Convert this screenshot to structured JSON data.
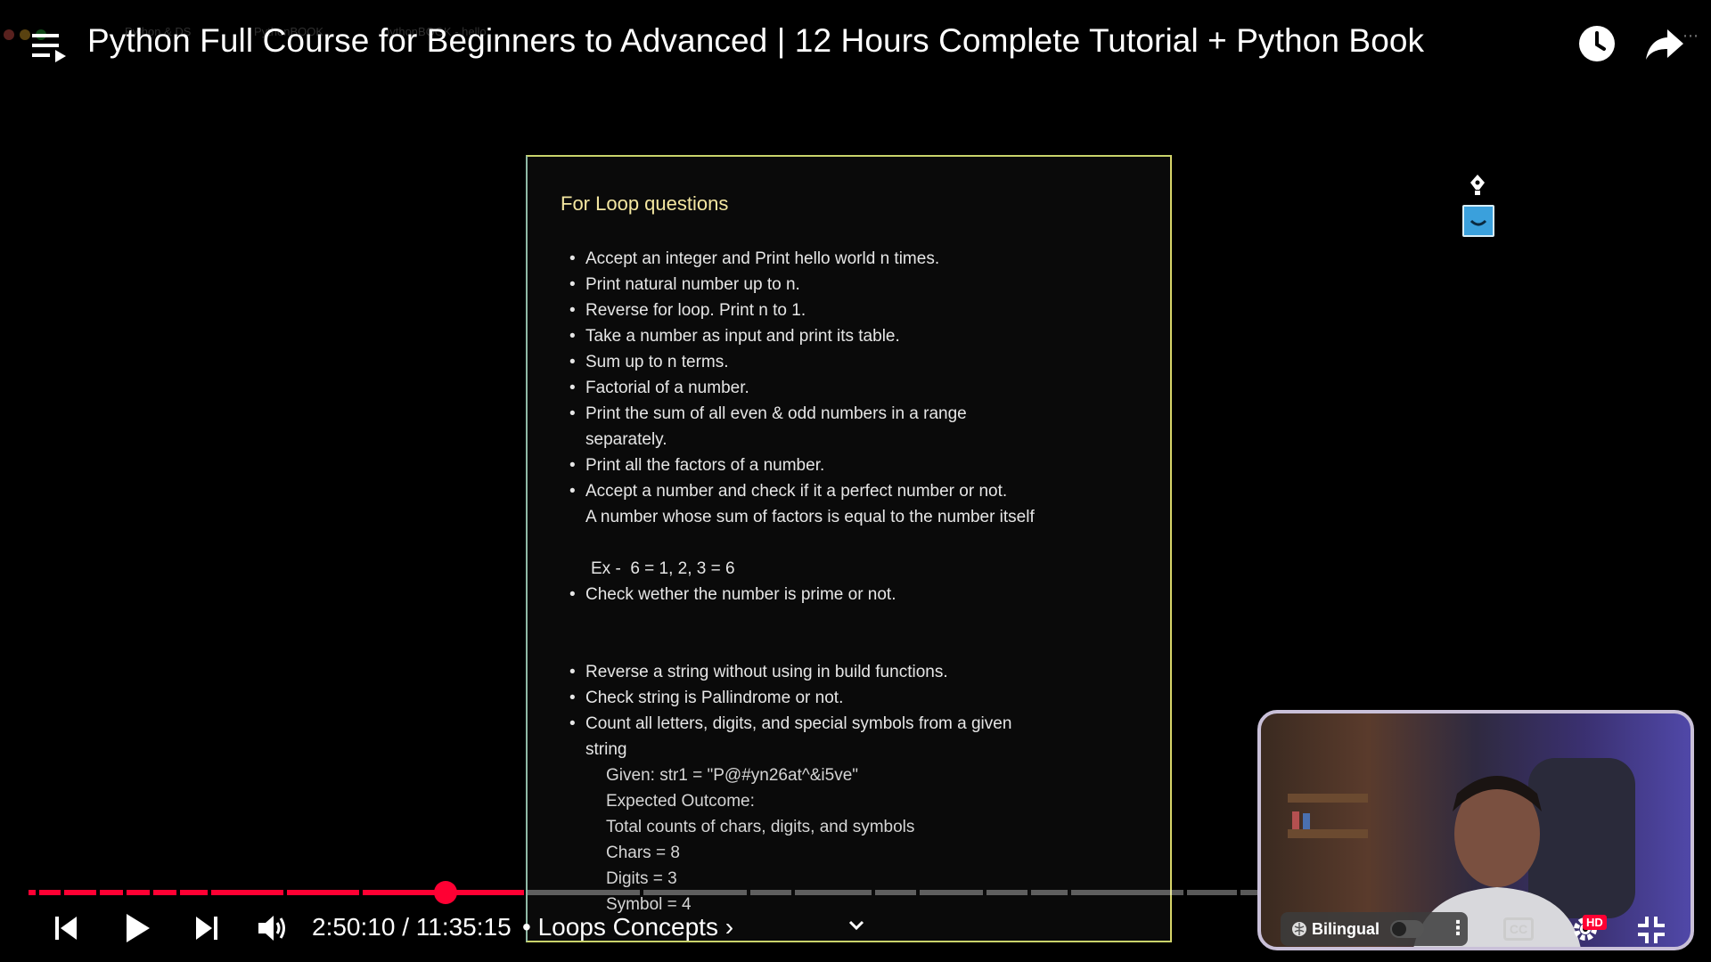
{
  "browser": {
    "tabs": [
      "Python & DS",
      "PythonBOOK",
      "pythonBOOK - hello"
    ]
  },
  "header": {
    "title": "Python Full Course for Beginners to Advanced | 12 Hours Complete Tutorial + Python Book",
    "menu_icon": "menu-icon",
    "watch_later_icon": "clock-icon",
    "share_icon": "share-icon"
  },
  "document": {
    "heading": "For Loop questions",
    "items": [
      "Accept an integer and Print hello world n times.",
      "Print natural number up to n.",
      "Reverse for loop. Print n to 1.",
      "Take a number as input and print its table.",
      "Sum up to n terms.",
      "Factorial of a number.",
      "Print the sum of all even & odd numbers in a range",
      "Print all the factors of a number.",
      "Accept a number and check if it a perfect number or not.",
      "Check wether the number is prime or not.",
      "Reverse a string without using in build functions.",
      "Check string is Pallindrome or not.",
      "Count all letters, digits, and special symbols from a given"
    ],
    "continuations": [
      "separately.",
      "A number whose sum of factors is equal to the number itself",
      "Ex -  6 = 1, 2, 3 = 6",
      "string"
    ],
    "example_lines": [
      "Given: str1 = \"P@#yn26at^&i5ve\"",
      "Expected Outcome:",
      "Total counts of chars, digits, and symbols",
      "Chars = 8",
      "Digits = 3",
      "Symbol = 4"
    ]
  },
  "player": {
    "current_time": "2:50:10",
    "duration": "11:35:15",
    "time_text": "2:50:10 / 11:35:15",
    "chapter": "• Loops Concepts ›",
    "progress_fraction": 0.245,
    "accent_color": "#ff0033",
    "bilingual_label": "Bilingual",
    "cc_label": "CC",
    "hd_label": "HD"
  }
}
